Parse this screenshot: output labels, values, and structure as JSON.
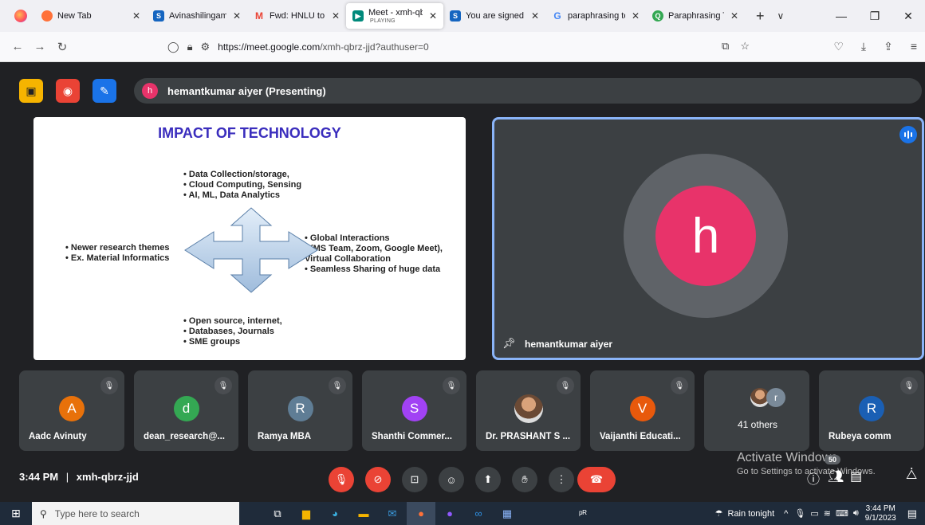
{
  "browser": {
    "tabs": [
      {
        "title": "New Tab",
        "icon": "firefox-icon",
        "color": "#ff7139"
      },
      {
        "title": "Avinashilingam W",
        "icon": "s-favicon",
        "color": "#1565c0"
      },
      {
        "title": "Fwd: HNLU to cor",
        "icon": "gmail-icon",
        "color": "#ea4335"
      },
      {
        "title": "Meet - xmh-qbrz",
        "subtitle": "PLAYING",
        "icon": "meet-icon",
        "color": "#00897b",
        "active": true
      },
      {
        "title": "You are signed in",
        "icon": "s-favicon",
        "color": "#1565c0"
      },
      {
        "title": "paraphrasing tool",
        "icon": "google-icon",
        "color": "#4285f4"
      },
      {
        "title": "Paraphrasing Tool",
        "icon": "quillbot-icon",
        "color": "#34a853"
      }
    ],
    "url_host": "https://meet.google.com",
    "url_path": "/xmh-qbrz-jjd?authuser=0"
  },
  "meet": {
    "presenter_initial": "h",
    "presenter_label": "hemantkumar aiyer (Presenting)",
    "slide": {
      "title": "IMPACT OF TECHNOLOGY",
      "top_bullets": [
        "Data Collection/storage,",
        "Cloud Computing, Sensing",
        "AI, ML, Data Analytics"
      ],
      "left_bullets": [
        "Newer research themes",
        "Ex. Material Informatics"
      ],
      "right_bullets": [
        "Global Interactions",
        "(MS Team, Zoom, Google Meet), Virtual Collaboration",
        "Seamless Sharing of huge data"
      ],
      "bottom_bullets": [
        "Open source, internet,",
        "Databases, Journals",
        "SME groups"
      ]
    },
    "speaker": {
      "initial": "h",
      "name": "hemantkumar aiyer",
      "color": "#e8336a"
    },
    "participants": [
      {
        "name": "Aadc Avinuty",
        "initial": "A",
        "color": "#e8710a"
      },
      {
        "name": "dean_research@...",
        "initial": "d",
        "color": "#34a853"
      },
      {
        "name": "Ramya MBA",
        "initial": "R",
        "color": "#5f7d95"
      },
      {
        "name": "Shanthi Commer...",
        "initial": "S",
        "color": "#a142f4"
      },
      {
        "name": "Dr. PRASHANT S ...",
        "initial": "",
        "color": "#6b4a35"
      },
      {
        "name": "Vaijanthi Educati...",
        "initial": "V",
        "color": "#e8590c"
      },
      {
        "name": "41 others",
        "initial": "r",
        "color": "#7a8a99"
      },
      {
        "name": "Rubeya comm",
        "initial": "R",
        "color": "#1a5fb4"
      }
    ],
    "time": "3:44 PM",
    "separator": "|",
    "meeting_code": "xmh-qbrz-jjd",
    "participant_count": "50",
    "activate_title": "Activate Windows",
    "activate_sub": "Go to Settings to activate Windows."
  },
  "taskbar": {
    "search_placeholder": "Type here to search",
    "weather": "Rain tonight",
    "clock_time": "3:44 PM",
    "clock_date": "9/1/2023"
  }
}
